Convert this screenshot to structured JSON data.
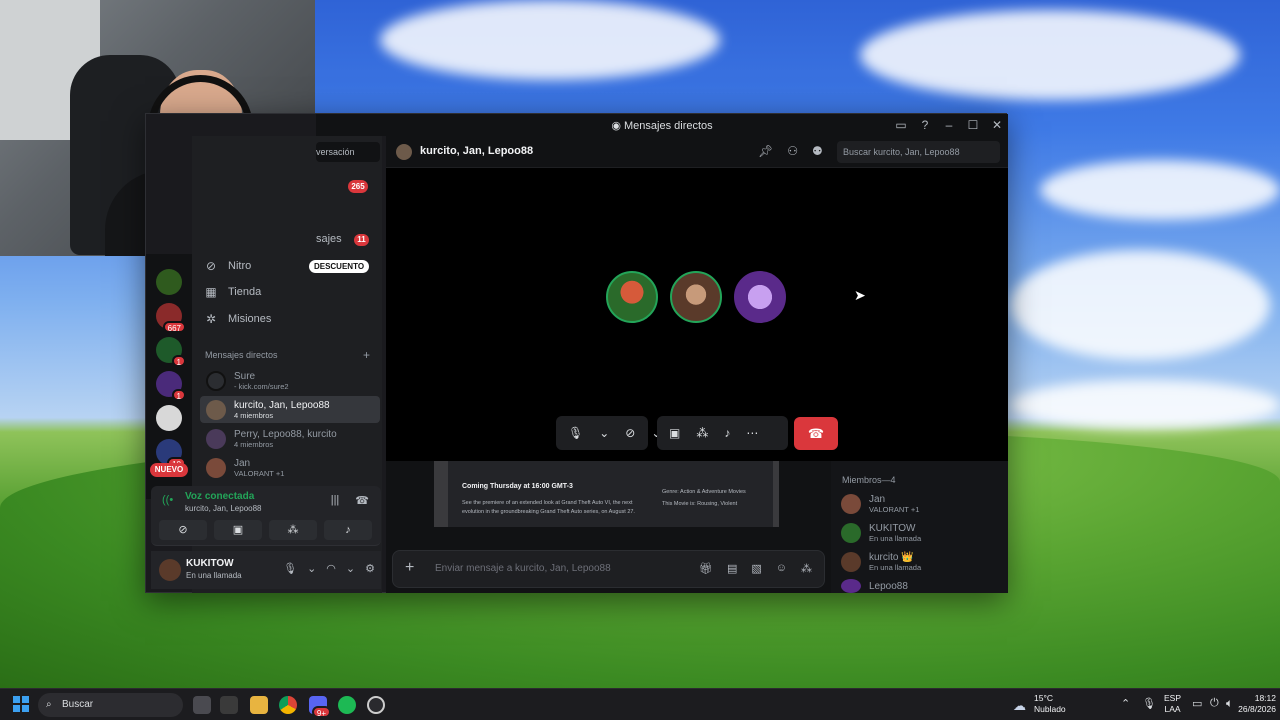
{
  "window": {
    "title": "Mensajes directos",
    "conversation_search": "versación"
  },
  "servers": {
    "badges": [
      "667",
      "1",
      "1",
      "10"
    ],
    "new_label": "NUEVO"
  },
  "sidebar": {
    "unread_counts": {
      "top": "265",
      "mensajes": "11"
    },
    "mensajes_fragment": "sajes",
    "nav": [
      {
        "label": "Nitro",
        "icon": "nitro-icon"
      },
      {
        "label": "Tienda",
        "icon": "shop-icon"
      },
      {
        "label": "Misiones",
        "icon": "quest-icon"
      }
    ],
    "nitro_badge": "DESCUENTO",
    "dm_header": "Mensajes directos",
    "dm_add": "+",
    "dms": [
      {
        "name": "Sure",
        "sub": "- kick.com/sure2"
      },
      {
        "name": "kurcito, Jan, Lepoo88",
        "sub": "4 miembros"
      },
      {
        "name": "Perry, Lepoo88, kurcito",
        "sub": "4 miembros"
      },
      {
        "name": "Jan",
        "sub": "VALORANT +1"
      }
    ]
  },
  "voice": {
    "title": "Voz conectada",
    "sub": "kurcito, Jan, Lepoo88"
  },
  "user": {
    "name": "KUKITOW",
    "status": "En una llamada"
  },
  "chat": {
    "header_title": "kurcito, Jan, Lepoo88",
    "search_placeholder": "Buscar kurcito, Jan, Lepoo88",
    "embed_title": "Coming Thursday at 16:00 GMT-3",
    "embed_text": "See the premiere of an extended look at Grand Theft Auto VI, the next evolution in the groundbreaking Grand Theft Auto series, on August 27.",
    "embed_genre": "Genre: Action & Adventure Movies",
    "embed_rating": "This Movie is: Rousing, Violent",
    "input_placeholder": "Enviar mensaje a kurcito, Jan, Lepoo88"
  },
  "members": {
    "header": "Miembros—4",
    "list": [
      {
        "name": "Jan",
        "sub": "VALORANT +1"
      },
      {
        "name": "KUKITOW",
        "sub": "En una llamada"
      },
      {
        "name": "kurcito 👑",
        "sub": "En una llamada"
      },
      {
        "name": "Lepoo88",
        "sub": ""
      }
    ]
  },
  "taskbar": {
    "search": "Buscar",
    "weather_temp": "15°C",
    "weather_desc": "Nublado",
    "lang_1": "ESP",
    "lang_2": "LAA",
    "time": "18:12",
    "date": "26/8/2026",
    "notif_badge": "9+"
  },
  "colors": {
    "accent_green": "#23a559",
    "danger_red": "#da373c",
    "background": "#1e1f22"
  }
}
